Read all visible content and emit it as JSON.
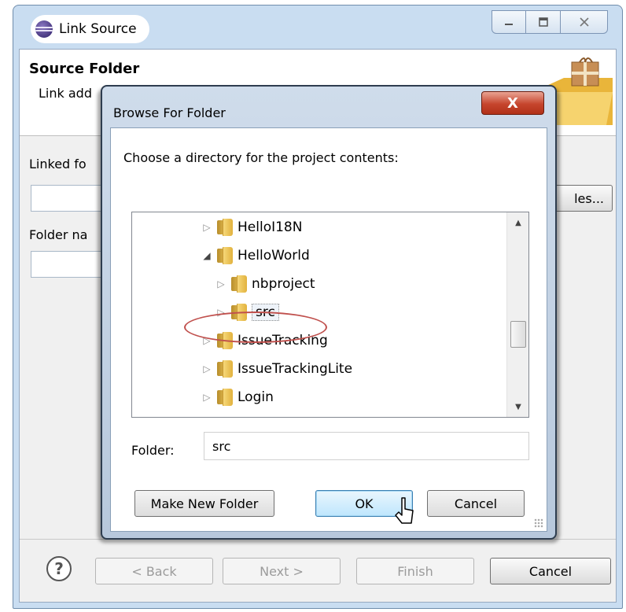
{
  "outer_dialog": {
    "title": "Link Source",
    "header_title": "Source Folder",
    "header_desc": "Link add",
    "linked_folder_label": "Linked fo",
    "browse_button_partial": "les...",
    "folder_name_label": "Folder na",
    "footer": {
      "back": "< Back",
      "next": "Next >",
      "finish": "Finish",
      "cancel": "Cancel"
    }
  },
  "browse_dialog": {
    "title": "Browse For Folder",
    "close_glyph": "X",
    "prompt": "Choose a directory for the project contents:",
    "tree": [
      {
        "label": "HelloI18N",
        "depth": 0,
        "expanded": false,
        "selected": false
      },
      {
        "label": "HelloWorld",
        "depth": 0,
        "expanded": true,
        "selected": false
      },
      {
        "label": "nbproject",
        "depth": 1,
        "expanded": false,
        "selected": false
      },
      {
        "label": "src",
        "depth": 1,
        "expanded": false,
        "selected": true
      },
      {
        "label": "IssueTracking",
        "depth": 0,
        "expanded": false,
        "selected": false
      },
      {
        "label": "IssueTrackingLite",
        "depth": 0,
        "expanded": false,
        "selected": false
      },
      {
        "label": "Login",
        "depth": 0,
        "expanded": false,
        "selected": false
      }
    ],
    "folder_label": "Folder:",
    "folder_value": "src",
    "make_new_folder": "Make New Folder",
    "ok": "OK",
    "cancel": "Cancel"
  },
  "colors": {
    "highlight_ellipse": "#c0504d",
    "close_button": "#c6452d",
    "selected_row_bg": "#eef3f9"
  }
}
